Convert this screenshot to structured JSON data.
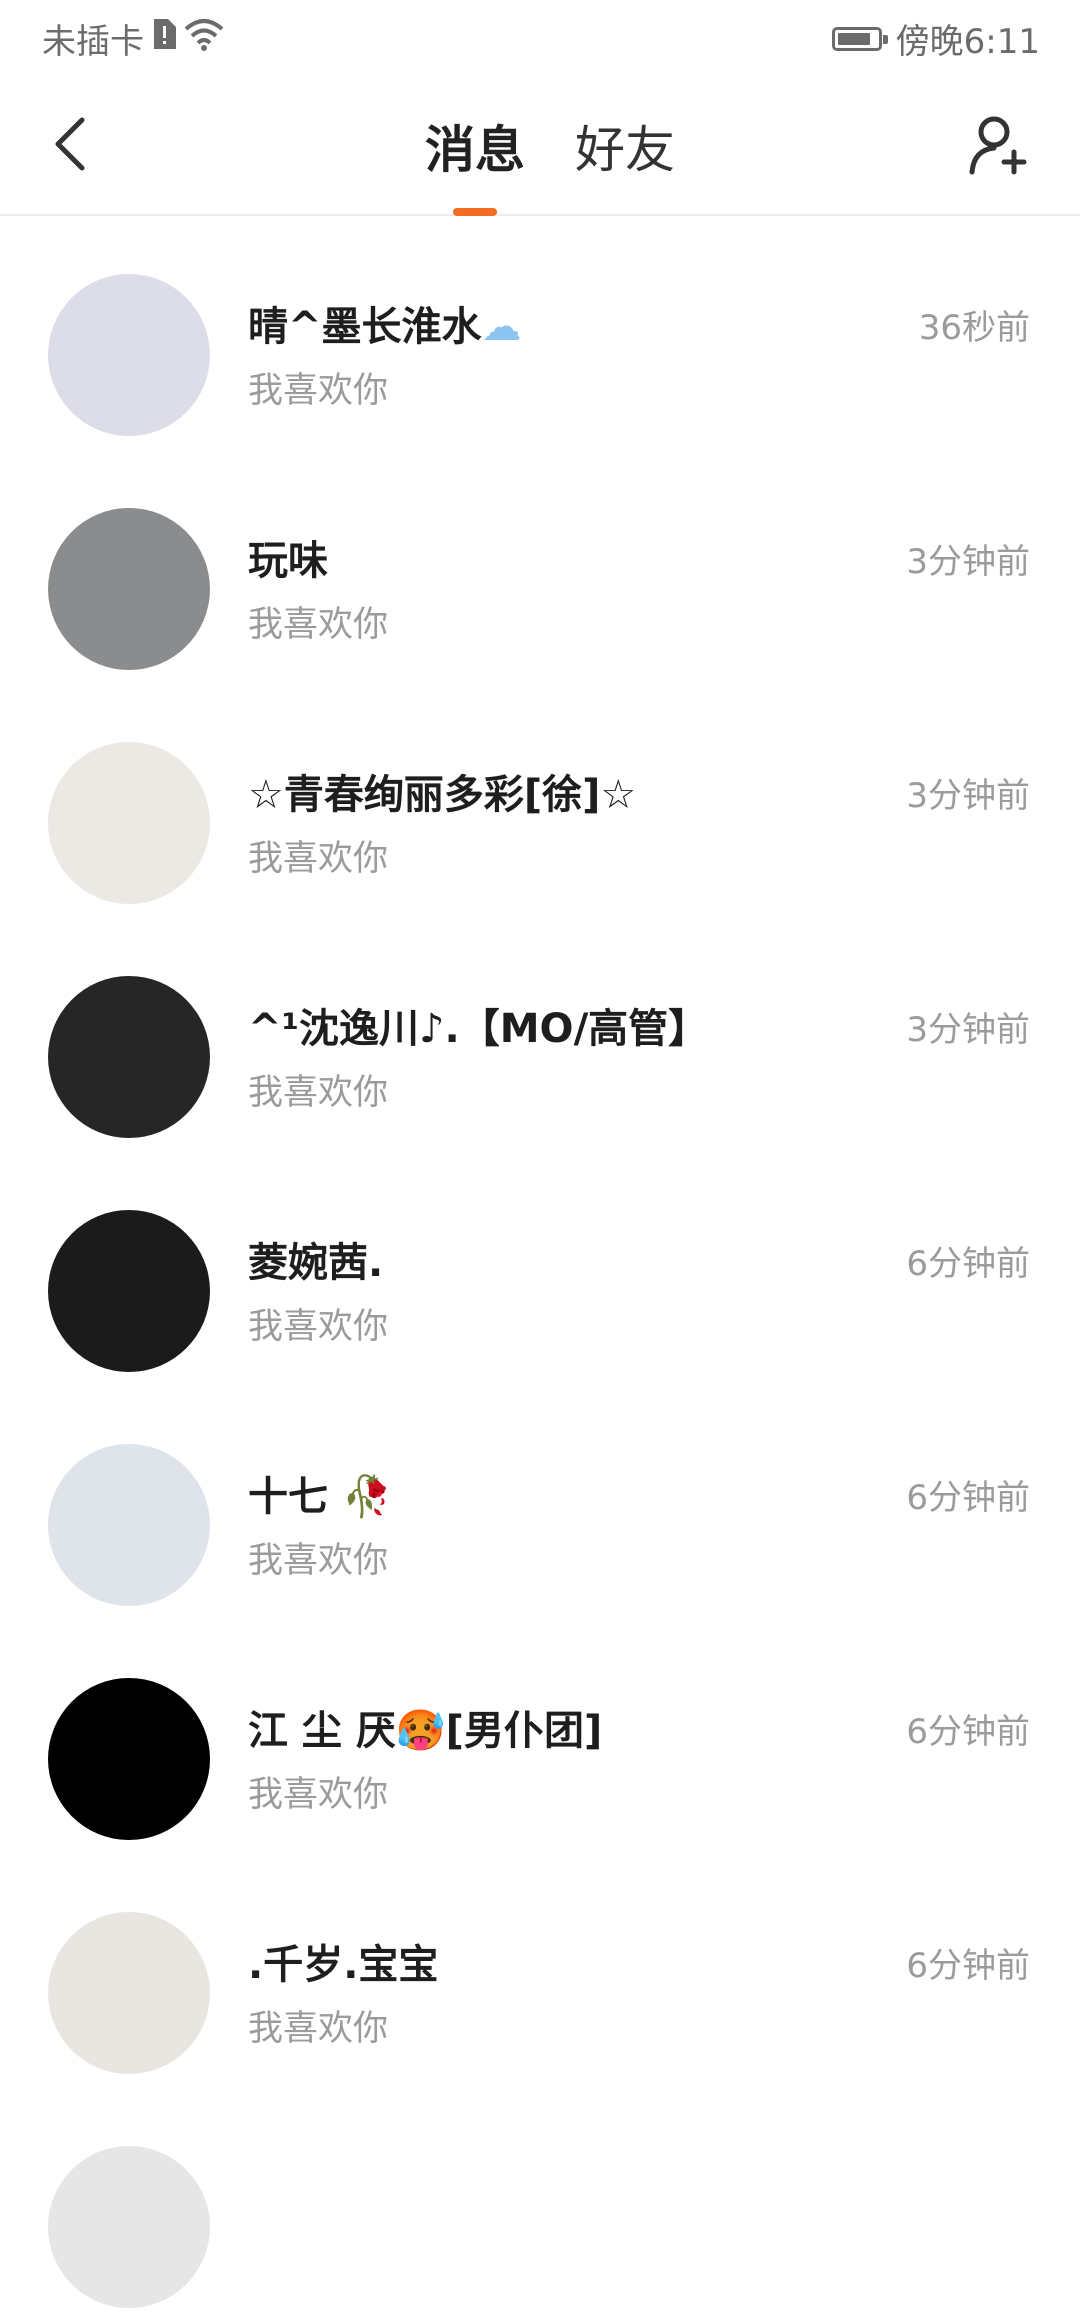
{
  "status_bar": {
    "carrier": "未插卡",
    "time": "傍晚6:11",
    "battery_level": 0.85
  },
  "header": {
    "tabs": [
      {
        "label": "消息",
        "active": true
      },
      {
        "label": "好友",
        "active": false
      }
    ],
    "accent_color": "#f26c21",
    "back_icon": "chevron-left-icon",
    "add_friend_icon": "add-user-icon"
  },
  "messages": [
    {
      "name": "晴^墨长淮水",
      "emoji": "☁",
      "preview": "我喜欢你",
      "time": "36秒前",
      "avatar_color": "#dcdde9"
    },
    {
      "name": "玩味",
      "emoji": "",
      "preview": "我喜欢你",
      "time": "3分钟前",
      "avatar_color": "#8a8c8d"
    },
    {
      "name": "☆青春绚丽多彩[徐]☆",
      "emoji": "",
      "preview": "我喜欢你",
      "time": "3分钟前",
      "avatar_color": "#ece9e4"
    },
    {
      "name": "^¹沈逸川♪.【MO/高管】",
      "emoji": "",
      "preview": "我喜欢你",
      "time": "3分钟前",
      "avatar_color": "#262626"
    },
    {
      "name": "菱婉茜.",
      "emoji": "",
      "preview": "我喜欢你",
      "time": "6分钟前",
      "avatar_color": "#1b1b1b"
    },
    {
      "name": "十七",
      "emoji": "🥀",
      "preview": "我喜欢你",
      "time": "6分钟前",
      "avatar_color": "#dfe3ea"
    },
    {
      "name": "江 尘 厌",
      "emoji": "🥵",
      "suffix": "[男仆团]",
      "preview": "我喜欢你",
      "time": "6分钟前",
      "avatar_color": "#000000"
    },
    {
      "name": ".千岁.宝宝",
      "emoji": "",
      "preview": "我喜欢你",
      "time": "6分钟前",
      "avatar_color": "#e9e6e2"
    }
  ]
}
